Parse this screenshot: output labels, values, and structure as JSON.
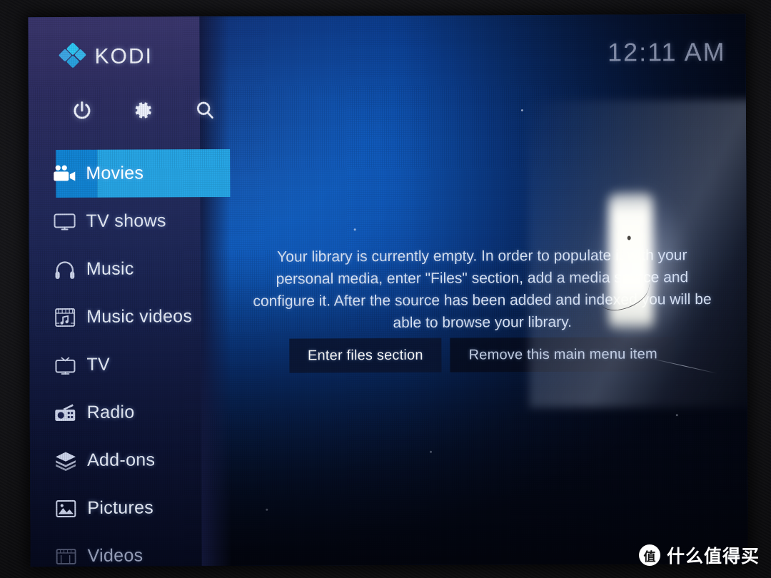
{
  "app": {
    "name": "KODI",
    "logo_icon": "kodi-diamond-logo",
    "clock": "12:11 AM"
  },
  "top_actions": [
    {
      "name": "power",
      "icon": "power-icon"
    },
    {
      "name": "settings",
      "icon": "gear-icon"
    },
    {
      "name": "search",
      "icon": "search-icon"
    }
  ],
  "sidebar": {
    "items": [
      {
        "label": "Movies",
        "icon": "movie-camera-icon",
        "selected": true,
        "dim": false
      },
      {
        "label": "TV shows",
        "icon": "monitor-icon",
        "selected": false,
        "dim": false
      },
      {
        "label": "Music",
        "icon": "headphones-icon",
        "selected": false,
        "dim": false
      },
      {
        "label": "Music videos",
        "icon": "film-note-icon",
        "selected": false,
        "dim": false
      },
      {
        "label": "TV",
        "icon": "television-icon",
        "selected": false,
        "dim": false
      },
      {
        "label": "Radio",
        "icon": "radio-icon",
        "selected": false,
        "dim": false
      },
      {
        "label": "Add-ons",
        "icon": "layers-box-icon",
        "selected": false,
        "dim": false
      },
      {
        "label": "Pictures",
        "icon": "picture-frame-icon",
        "selected": false,
        "dim": false
      },
      {
        "label": "Videos",
        "icon": "film-strip-icon",
        "selected": false,
        "dim": true
      }
    ]
  },
  "main": {
    "empty_message": "Your library is currently empty. In order to populate it with your personal media, enter \"Files\" section, add a media source and configure it. After the source has been added and indexed you will be able to browse your library.",
    "buttons": [
      {
        "label": "Enter files section",
        "focused": true
      },
      {
        "label": "Remove this main menu item",
        "focused": false
      }
    ]
  },
  "watermark": {
    "badge": "值",
    "text": "什么值得买"
  },
  "colors": {
    "accent_selected_text": "#27a6e6",
    "accent_selected_icon": "#1284d4",
    "logo_blue": "#2fc8f5",
    "background_blue": "#1059ba",
    "sidebar_navy": "#242a5c"
  }
}
